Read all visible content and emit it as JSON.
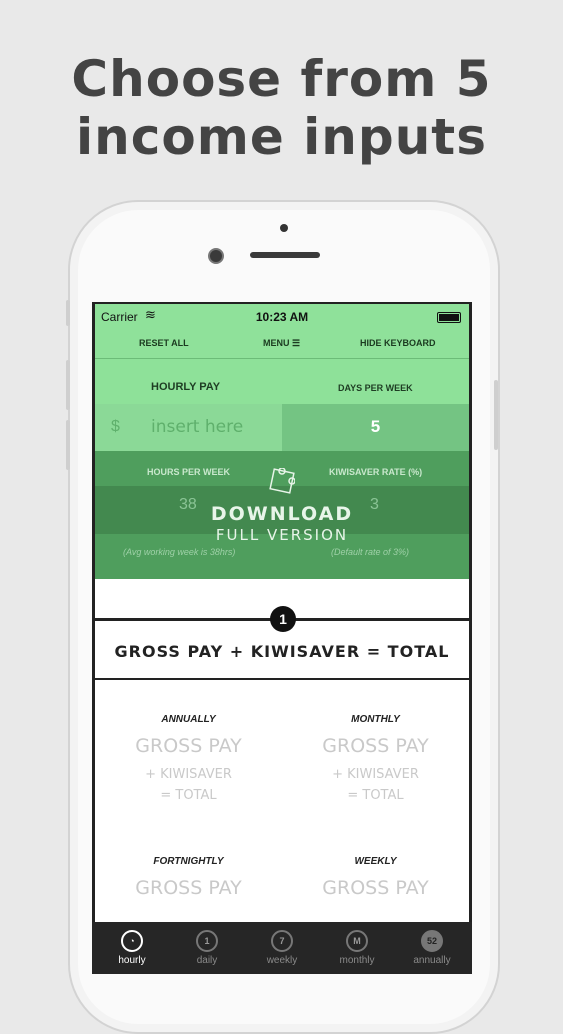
{
  "headline": {
    "line1": "Choose from 5",
    "line2": "income inputs"
  },
  "status_bar": {
    "carrier": "Carrier",
    "time": "10:23 AM"
  },
  "toolbar": {
    "reset": "RESET ALL",
    "menu": "MENU ☰",
    "hide_keyboard": "HIDE KEYBOARD"
  },
  "inputs": {
    "hourly_pay_label": "HOURLY PAY",
    "days_per_week_label": "DAYS PER WEEK",
    "currency_symbol": "$",
    "hourly_pay_placeholder": "insert here",
    "days_per_week_value": "5",
    "hours_per_week_label": "HOURS PER WEEK",
    "kiwisaver_rate_label": "KIWISAVER RATE (%)",
    "hours_per_week_value": "38",
    "kiwisaver_rate_value": "3",
    "hours_hint": "(Avg working week is 38hrs)",
    "kiwisaver_hint": "(Default rate of 3%)"
  },
  "overlay": {
    "line1": "DOWNLOAD",
    "line2": "FULL VERSION"
  },
  "step_badge": "1",
  "formula": "GROSS PAY + KIWISAVER = TOTAL",
  "periods": [
    {
      "name": "ANNUALLY",
      "gross": "GROSS PAY",
      "kiwi": "+ KIWISAVER",
      "total": "= TOTAL"
    },
    {
      "name": "MONTHLY",
      "gross": "GROSS PAY",
      "kiwi": "+ KIWISAVER",
      "total": "= TOTAL"
    },
    {
      "name": "FORTNIGHTLY",
      "gross": "GROSS PAY"
    },
    {
      "name": "WEEKLY",
      "gross": "GROSS PAY"
    }
  ],
  "tabs": [
    {
      "label": "hourly",
      "icon": "clock-icon",
      "glyph": ""
    },
    {
      "label": "daily",
      "icon": "day-icon",
      "glyph": "1"
    },
    {
      "label": "weekly",
      "icon": "week-icon",
      "glyph": "7"
    },
    {
      "label": "monthly",
      "icon": "month-icon",
      "glyph": "M"
    },
    {
      "label": "annually",
      "icon": "year-icon",
      "glyph": "52"
    }
  ],
  "colors": {
    "accent_green": "#8fe19a",
    "dark_green": "#4f9e5d"
  }
}
